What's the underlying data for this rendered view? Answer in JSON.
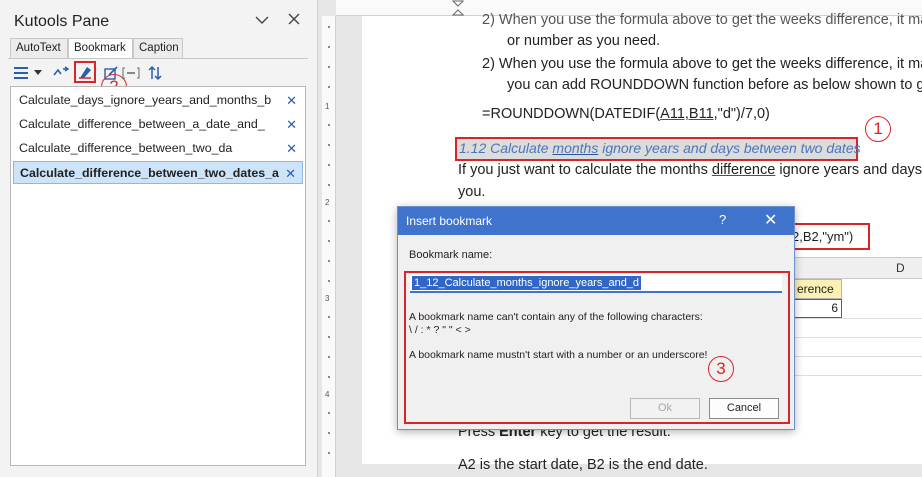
{
  "pane": {
    "title": "Kutools Pane",
    "tabs": [
      "AutoText",
      "Bookmark",
      "Caption"
    ],
    "active_tab": "Bookmark",
    "bookmarks": [
      "Calculate_days_ignore_years_and_months_b",
      "Calculate_difference_between_a_date_and_",
      "Calculate_difference_between_two_da",
      "Calculate_difference_between_two_dates_a"
    ],
    "remove_glyph": "✕",
    "callout_2": "2"
  },
  "doc": {
    "line1": "2)   When you use the formula above to get the weeks difference, it ma",
    "line2": "or number as you need.",
    "line3": "2)   When you use the formula above to get the weeks difference, it ma",
    "line4": "you can add ROUNDDOWN function before as below shown to ge",
    "formula_a": "=ROUNDDOWN(DATEDIF(",
    "formula_b": "A11,B11",
    "formula_c": ",\"d\")/7,0)",
    "heading_a": "1.12 Calculate ",
    "heading_b": "months",
    "heading_c": " ignore years and days between two dates",
    "para_a": "If you just want to calculate the months ",
    "para_b": "difference",
    "para_c": " ignore years and days",
    "para_d": "you.",
    "press_a": "Press ",
    "press_b": "Enter",
    "press_c": " key to get the result.",
    "last_line": "A2 is the start date, B2 is the end date.",
    "callout_1": "1",
    "ruler_numbers": [
      "1",
      "2",
      "3",
      "4"
    ]
  },
  "sheet": {
    "formula_text": "2,B2,\"ym\")",
    "column_d": "D",
    "header_cell": "erence",
    "value_cell": "6"
  },
  "dialog": {
    "title": "Insert bookmark",
    "help": "?",
    "close": "✕",
    "name_label": "Bookmark name:",
    "name_value": "1_12_Calculate_months_ignore_years_and_d",
    "msg1": "A bookmark name can't contain any of the following characters:",
    "msg2": "\\ / : * ? \" \" < >",
    "msg3": "A bookmark name mustn't start with a number or an underscore!",
    "ok": "Ok",
    "cancel": "Cancel",
    "callout_3": "3"
  }
}
